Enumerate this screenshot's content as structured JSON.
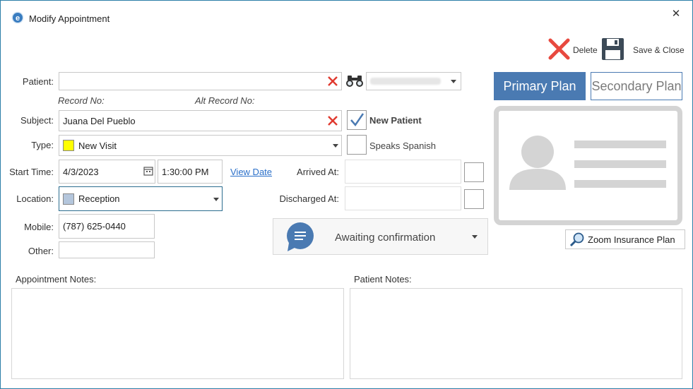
{
  "window": {
    "title": "Modify Appointment",
    "close_glyph": "✕"
  },
  "toolbar": {
    "delete_label": "Delete",
    "save_close_label": "Save & Close"
  },
  "form": {
    "patient_label": "Patient:",
    "patient_value": "",
    "record_no_label": "Record No:",
    "alt_record_no_label": "Alt Record No:",
    "subject_label": "Subject:",
    "subject_value": "Juana Del Pueblo",
    "type_label": "Type:",
    "type_value": "New Visit",
    "type_color": "#ffff00",
    "start_time_label": "Start Time:",
    "start_date_value": "4/3/2023",
    "start_time_value": "1:30:00 PM",
    "view_date_link": "View Date",
    "arrived_at_label": "Arrived At:",
    "discharged_at_label": "Discharged At:",
    "location_label": "Location:",
    "location_value": "Reception",
    "location_color": "#b4c6dc",
    "mobile_label": "Mobile:",
    "mobile_value": "(787) 625-0440",
    "other_label": "Other:",
    "other_value": "",
    "new_patient_label": "New Patient",
    "new_patient_checked": true,
    "speaks_spanish_label": "Speaks Spanish",
    "speaks_spanish_checked": false
  },
  "status": {
    "label": "Awaiting confirmation",
    "icon": "chat-bubble-icon"
  },
  "insurance": {
    "primary_plan_label": "Primary Plan",
    "secondary_plan_label": "Secondary Plan",
    "zoom_label": "Zoom Insurance Plan",
    "accent": "#4a7ab2"
  },
  "notes": {
    "appointment_notes_label": "Appointment Notes:",
    "appointment_notes_value": "",
    "patient_notes_label": "Patient Notes:",
    "patient_notes_value": ""
  }
}
